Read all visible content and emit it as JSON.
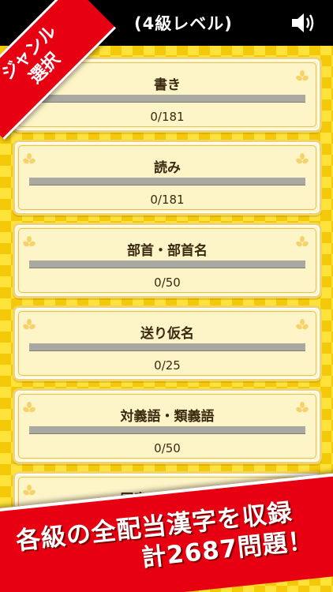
{
  "header": {
    "title": "(4級レベル)",
    "sound_icon": "speaker-icon"
  },
  "ribbon": {
    "text": "ジャンル\n選択"
  },
  "genres": [
    {
      "label": "書き",
      "count": "0/181",
      "progress": 0
    },
    {
      "label": "読み",
      "count": "0/181",
      "progress": 0
    },
    {
      "label": "部首・部首名",
      "count": "0/50",
      "progress": 0
    },
    {
      "label": "送り仮名",
      "count": "0/25",
      "progress": 0
    },
    {
      "label": "対義語・類義語",
      "count": "0/50",
      "progress": 0
    },
    {
      "label": "同音・同訓異字",
      "count": "",
      "progress": 0
    }
  ],
  "banner": {
    "line1": "各級の全配当漢字を収録",
    "line2": "計2687問題！"
  },
  "colors": {
    "accent_red": "#e60012",
    "card_bg": "#fdf4c8",
    "progress_track": "#a9a9a1"
  }
}
